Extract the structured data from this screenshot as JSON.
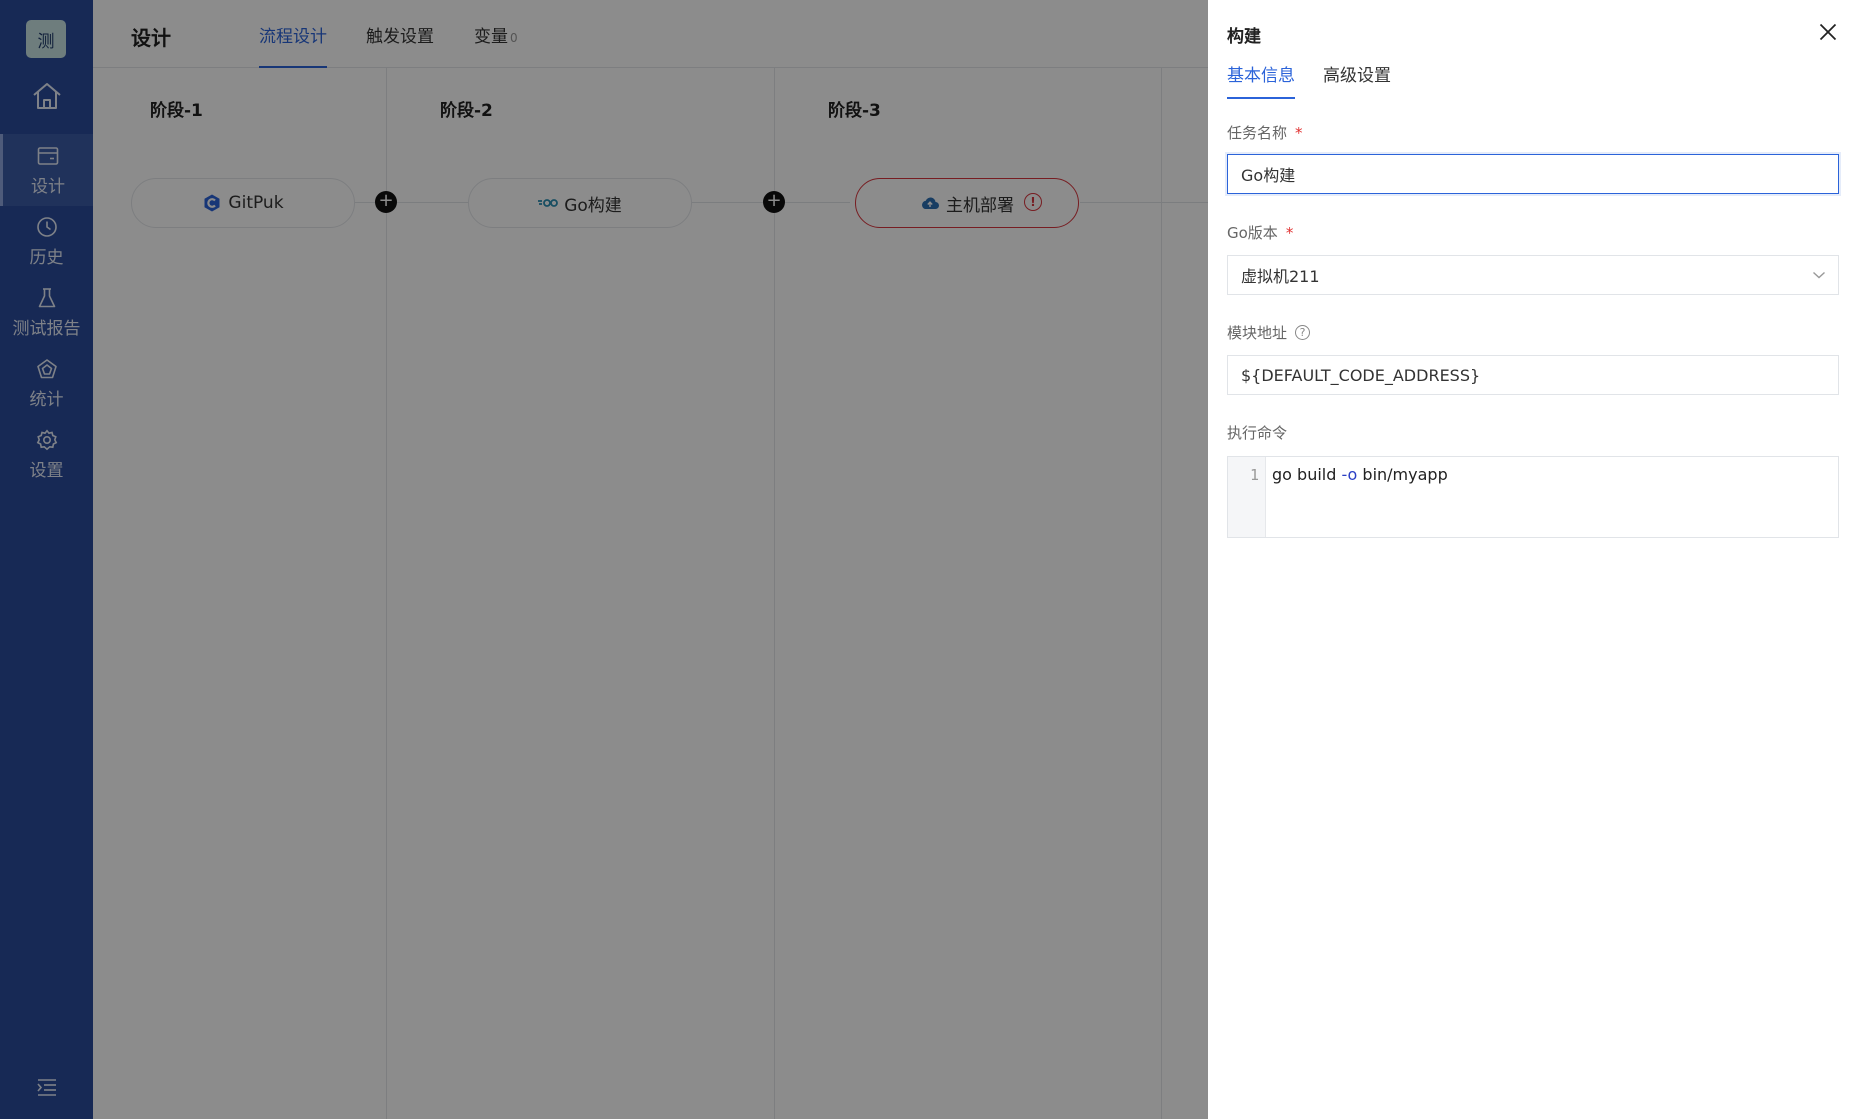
{
  "sidebar": {
    "logo": "测",
    "items": [
      {
        "label": "设计",
        "icon": "design-icon",
        "active": true
      },
      {
        "label": "历史",
        "icon": "clock-icon"
      },
      {
        "label": "测试报告",
        "icon": "flask-icon"
      },
      {
        "label": "统计",
        "icon": "chart-pentagon-icon"
      },
      {
        "label": "设置",
        "icon": "gear-icon"
      }
    ],
    "home_icon": "home-icon",
    "collapse_icon": "collapse-menu-icon"
  },
  "header": {
    "title": "设计",
    "tabs": [
      {
        "label": "流程设计",
        "active": true
      },
      {
        "label": "触发设置"
      },
      {
        "label": "变量",
        "count": "0"
      }
    ]
  },
  "stages": [
    {
      "title": "阶段-1",
      "task": {
        "label": "GitPuk",
        "icon": "gitpuk-icon"
      }
    },
    {
      "title": "阶段-2",
      "task": {
        "label": "Go构建",
        "icon": "go-icon"
      }
    },
    {
      "title": "阶段-3",
      "task": {
        "label": "主机部署",
        "icon": "cloud-deploy-icon",
        "status": "error"
      }
    }
  ],
  "drawer": {
    "title": "构建",
    "tabs": [
      {
        "label": "基本信息",
        "active": true
      },
      {
        "label": "高级设置"
      }
    ],
    "fields": {
      "task_name": {
        "label": "任务名称",
        "required": "*",
        "value": "Go构建"
      },
      "go_version": {
        "label": "Go版本",
        "required": "*",
        "value": "虚拟机211"
      },
      "module_address": {
        "label": "模块地址",
        "help": "?",
        "value": "${DEFAULT_CODE_ADDRESS}"
      },
      "command": {
        "label": "执行命令",
        "line_number": "1",
        "code_before": "go build ",
        "code_flag": "-o",
        "code_after": " bin/myapp"
      }
    }
  },
  "colors": {
    "sidebar": "#2b4c9c",
    "accent": "#2b63d9",
    "error": "#d9363e"
  }
}
